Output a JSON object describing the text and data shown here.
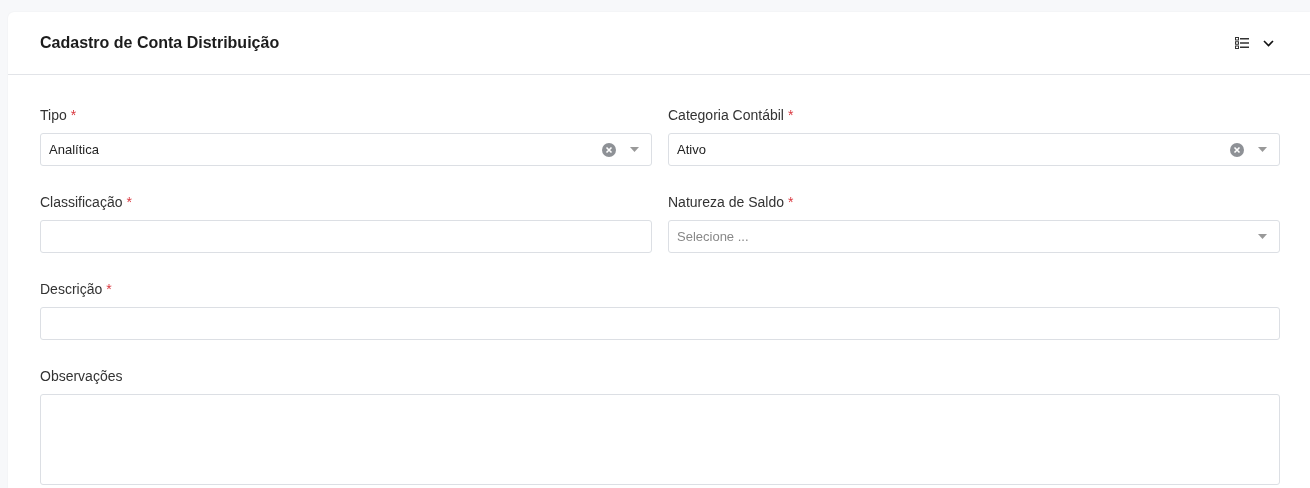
{
  "card": {
    "title": "Cadastro de Conta Distribuição"
  },
  "rows": [
    {
      "fields": [
        {
          "kind": "select",
          "label": "Tipo",
          "required_mark": "*",
          "value": "Analítica",
          "clearable": true
        },
        {
          "kind": "select",
          "label": "Categoria Contábil",
          "required_mark": "*",
          "value": "Ativo",
          "clearable": true
        }
      ]
    },
    {
      "fields": [
        {
          "kind": "text",
          "label": "Classificação",
          "required_mark": "*"
        },
        {
          "kind": "select",
          "label": "Natureza de Saldo",
          "required_mark": "*",
          "placeholder": "Selecione ...",
          "clearable": false
        }
      ]
    },
    {
      "fields": [
        {
          "kind": "text",
          "label": "Descrição",
          "required_mark": "*"
        }
      ]
    },
    {
      "fields": [
        {
          "kind": "textarea",
          "label": "Observações"
        }
      ]
    }
  ]
}
